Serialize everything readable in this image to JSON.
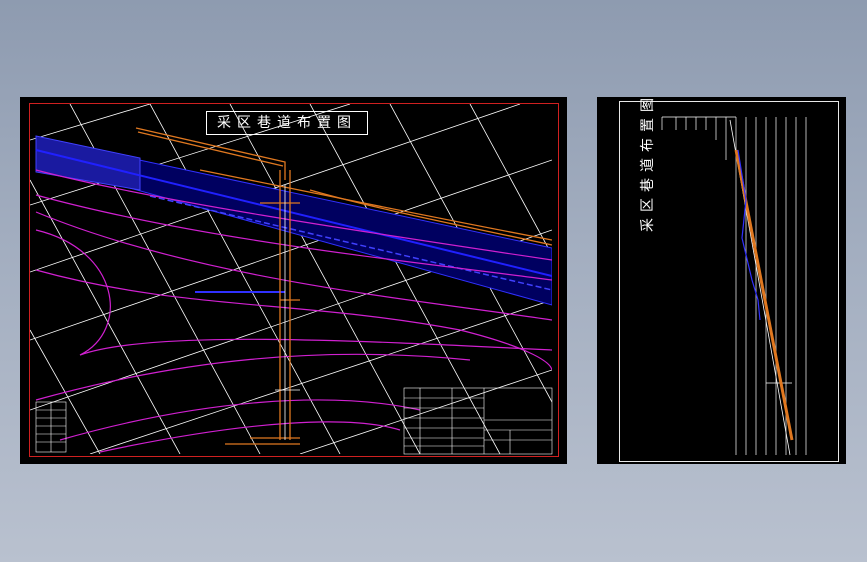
{
  "main_drawing": {
    "title": "采区巷道布置图"
  },
  "section_drawing": {
    "title": "采区巷道布置图"
  },
  "colors": {
    "background": "#000000",
    "grid": "#ffffff",
    "roadway": "#e07820",
    "seam": "#2020ff",
    "contour": "#d020d0",
    "frame_main": "#d02020",
    "frame_side": "#e8e8e8"
  }
}
